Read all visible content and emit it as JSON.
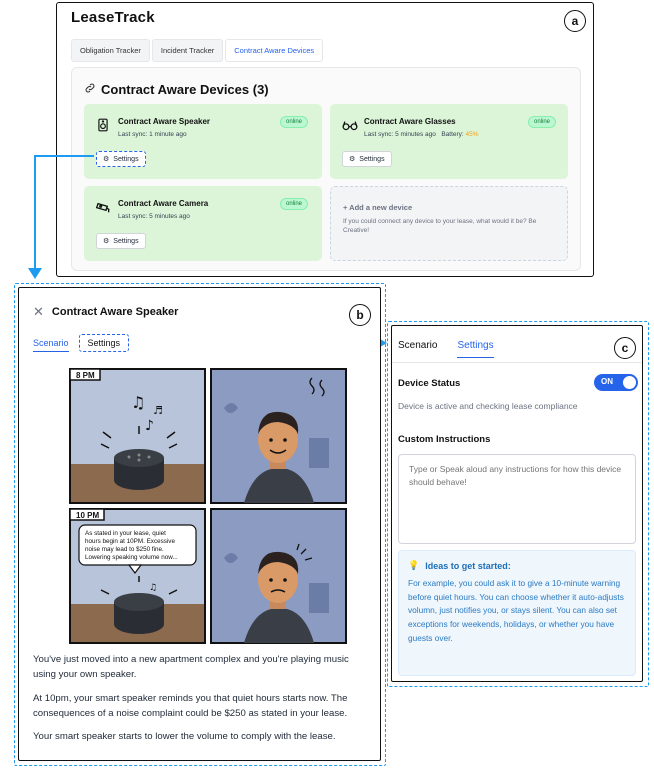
{
  "app": {
    "brand": "LeaseTrack"
  },
  "tabs": [
    "Obligation Tracker",
    "Incident Tracker",
    "Contract Aware Devices"
  ],
  "devices_section": {
    "title": "Contract Aware Devices (3)",
    "devices": [
      {
        "name": "Contract Aware Speaker",
        "sync": "Last sync: 1 minute ago",
        "status": "online",
        "settings": "Settings",
        "icon": "speaker-icon"
      },
      {
        "name": "Contract Aware Glasses",
        "sync": "Last sync: 5 minutes ago",
        "battery_label": "Battery:",
        "battery": "45%",
        "status": "online",
        "settings": "Settings",
        "icon": "glasses-icon"
      },
      {
        "name": "Contract Aware Camera",
        "sync": "Last sync: 5 minutes ago",
        "status": "online",
        "settings": "Settings",
        "icon": "camera-icon"
      }
    ],
    "add_device": {
      "title": "+ Add a new device",
      "description": "If you could connect any device to your lease, what would it be? Be Creative!"
    }
  },
  "badges": {
    "a": "a",
    "b": "b",
    "c": "c"
  },
  "detail": {
    "title": "Contract Aware Speaker",
    "tabs": {
      "scenario": "Scenario",
      "settings": "Settings"
    },
    "comic": {
      "panel1_time": "8 PM",
      "panel3_time": "10 PM",
      "speech": [
        "As stated in your lease, quiet",
        "hours begin at 10PM. Excessive",
        "noise may lead to $250 fine.",
        "Lowering speaking volume now..."
      ]
    },
    "story": [
      "You've just moved into a new apartment complex and you're playing music using your own speaker.",
      "At 10pm, your smart speaker reminds you that quiet hours starts now. The consequences of a noise complaint could be $250 as stated in your lease.",
      "Your smart speaker starts to lower the volume to comply with the lease."
    ]
  },
  "settings_panel": {
    "tabs": {
      "scenario": "Scenario",
      "settings": "Settings"
    },
    "device_status_label": "Device Status",
    "toggle": "ON",
    "status_text": "Device is active and checking lease compliance",
    "custom_label": "Custom Instructions",
    "placeholder": "Type or Speak aloud any instructions for how this device should behave!",
    "ideas_title": "Ideas to get started:",
    "ideas_body": "For example, you could ask it to give a 10-minute warning before quiet hours. You can choose whether it auto-adjusts volumn, just notifies you, or stays silent. You can also set exceptions for weekends, holidays, or whether you have guests over."
  },
  "colors": {
    "accent": "#2563eb",
    "arrow": "#1d9bf0",
    "device_bg": "#dcf5d9",
    "battery": "#f59e0b"
  }
}
